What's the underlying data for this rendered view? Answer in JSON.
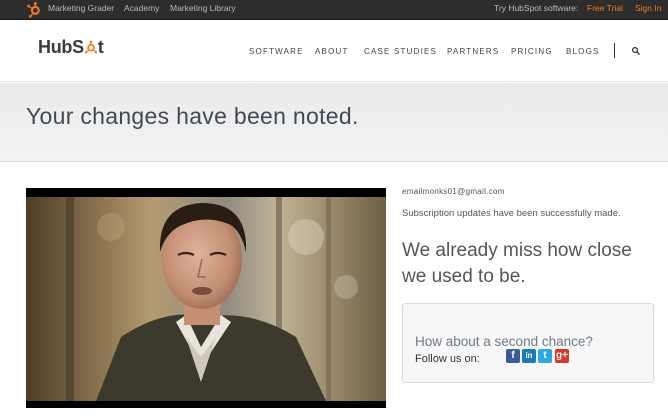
{
  "topbar": {
    "links": [
      "Marketing Grader",
      "Academy",
      "Marketing Library"
    ],
    "try_label": "Try HubSpot software:",
    "free_trial": "Free Trial",
    "sign_in": "Sign In"
  },
  "header": {
    "logo_text_a": "HubS",
    "logo_text_b": "t",
    "nav": [
      "SOFTWARE",
      "ABOUT",
      "CASE STUDIES",
      "PARTNERS",
      "PRICING",
      "BLOGS"
    ]
  },
  "banner": {
    "title": "Your changes have been noted."
  },
  "content": {
    "email": "emailmonks01@gmail.com",
    "success": "Subscription updates have been successfully made.",
    "miss_line1": "We already miss how close",
    "miss_line2": "we used to be.",
    "chance_question": "How about a second chance?",
    "follow_label": "Follow us on:"
  },
  "social": {
    "facebook": "f",
    "linkedin": "in",
    "twitter": "t",
    "googleplus": "g+"
  },
  "colors": {
    "brand_orange": "#f57b20",
    "topbar": "#2d2d2d",
    "heading": "#3f4a56"
  },
  "icons": [
    "sprocket-icon",
    "search-icon",
    "facebook-icon",
    "linkedin-icon",
    "twitter-icon",
    "googleplus-icon"
  ]
}
